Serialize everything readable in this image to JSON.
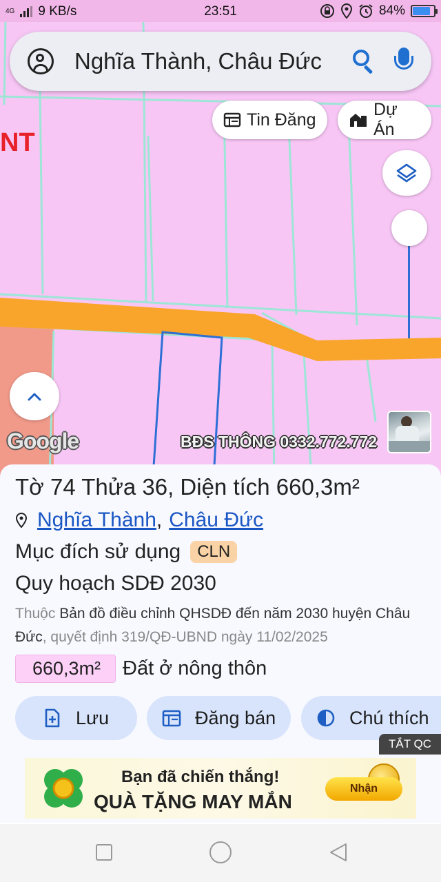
{
  "status_bar": {
    "network_type": "4G",
    "speed": "9 KB/s",
    "time": "23:51",
    "battery": "84%",
    "battery_level": 0.84
  },
  "search": {
    "query": "Nghĩa Thành, Châu Đức"
  },
  "map": {
    "chips": {
      "listings": "Tin Đăng",
      "projects": "Dự Án"
    },
    "edge_label": "NT",
    "google_logo": "Google",
    "watermark": "BĐS THÔNG 0332.772.772",
    "colors": {
      "land_residential": "#f7c6f5",
      "road": "#f9a52b",
      "edge_area": "#f29a8a",
      "parcel_lines": "#9de6d6",
      "selected_parcel": "#2e6fd6"
    },
    "zoom_slider_level": 1.0
  },
  "parcel": {
    "title": "Tờ 74 Thửa 36, Diện tích 660,3m²",
    "commune": "Nghĩa Thành",
    "separator": ",",
    "district": "Châu Đức",
    "purpose_label": "Mục đích sử dụng",
    "purpose_code": "CLN",
    "plan_title": "Quy hoạch SDĐ 2030",
    "desc_prefix": "Thuộc",
    "desc_main": "Bản đồ điều chỉnh QHSDĐ đến năm 2030 huyện Châu Đức",
    "desc_suffix": ", quyết định 319/QĐ-UBND ngày 11/02/2025",
    "area_value": "660,3m²",
    "area_type": "Đất ở nông thôn"
  },
  "actions": {
    "save": "Lưu",
    "post_sale": "Đăng bán",
    "legend": "Chú thích"
  },
  "ad": {
    "close_label": "TẮT QC",
    "line1": "Bạn đã chiến thắng!",
    "line2": "QUÀ TẶNG MAY MẮN",
    "cta": "Nhận"
  },
  "icons": [
    "account-icon",
    "search-icon",
    "mic-icon",
    "listings-icon",
    "projects-icon",
    "layers-icon",
    "chevron-up-icon",
    "pin-icon",
    "add-file-icon",
    "calendar-icon",
    "contrast-icon",
    "nav-recent-icon",
    "nav-home-icon",
    "nav-back-icon"
  ]
}
